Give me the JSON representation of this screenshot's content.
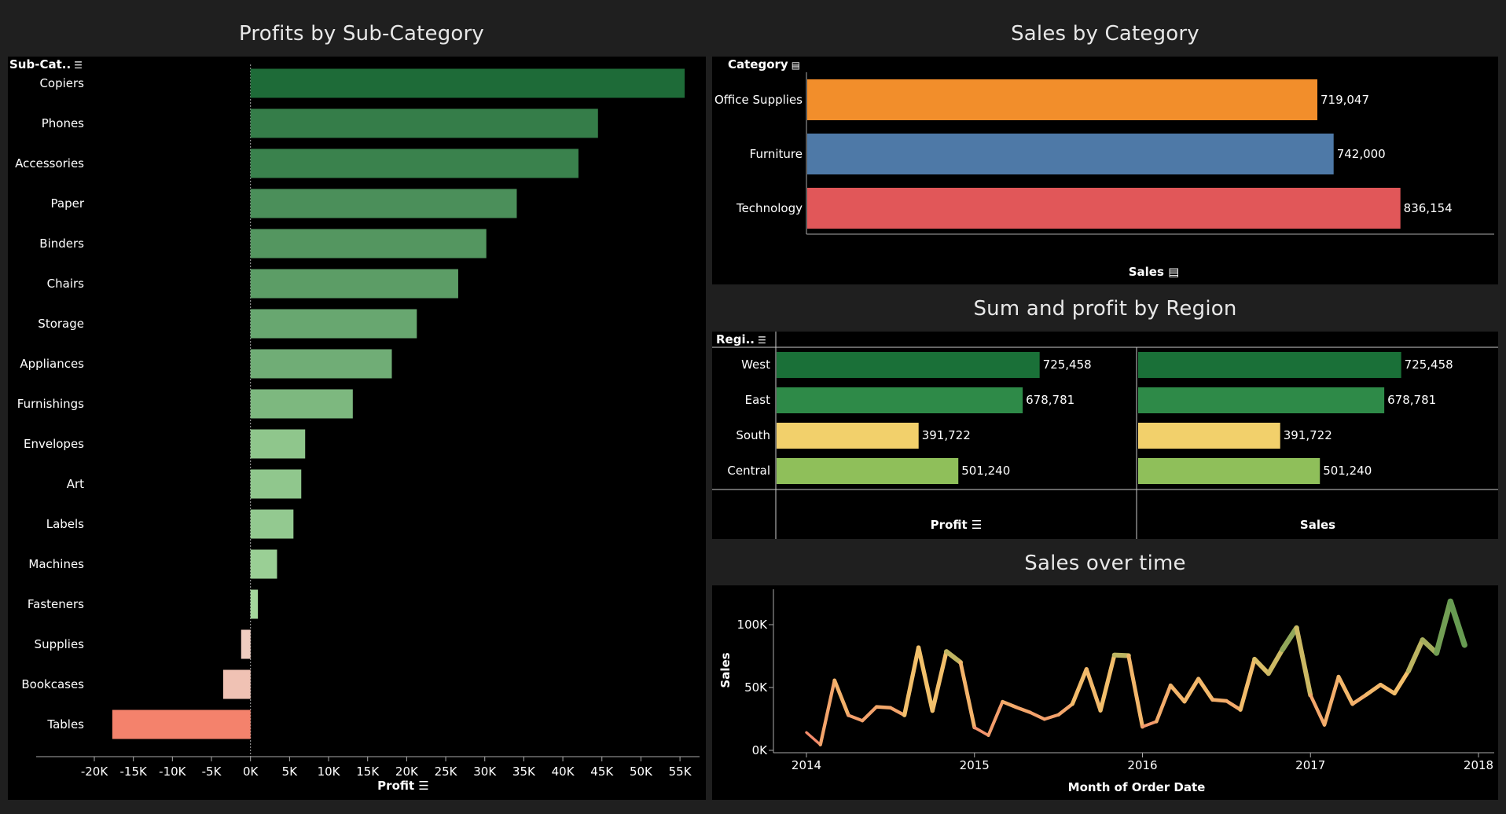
{
  "dashboard": {
    "profits": {
      "title": "Profits by Sub-Category",
      "header": "Sub-Cat..",
      "xlabel": "Profit"
    },
    "category": {
      "title": "Sales by Category",
      "header": "Category",
      "xlabel": "Sales"
    },
    "region": {
      "title": "Sum and profit by Region",
      "header": "Regi..",
      "profit_label": "Profit",
      "sales_label": "Sales"
    },
    "time": {
      "title": "Sales over time",
      "xlabel": "Month of Order Date",
      "ylabel": "Sales"
    }
  },
  "colors": {
    "positive_dark": "#1e6b38",
    "negative": "#f4826c",
    "office_supplies": "#f28e2b",
    "furniture": "#4e79a7",
    "technology": "#e15759",
    "west": "#1a7038",
    "east": "#2e8a48",
    "south": "#f2d06b",
    "central": "#8fbf5a",
    "background": "#000000",
    "canvas": "#1f1f1f"
  },
  "chart_data": [
    {
      "type": "bar",
      "orientation": "horizontal",
      "title": "Profits by Sub-Category",
      "xlabel": "Profit",
      "ylabel": "Sub-Cat..",
      "categories": [
        "Copiers",
        "Phones",
        "Accessories",
        "Paper",
        "Binders",
        "Chairs",
        "Storage",
        "Appliances",
        "Furnishings",
        "Envelopes",
        "Art",
        "Labels",
        "Machines",
        "Fasteners",
        "Supplies",
        "Bookcases",
        "Tables"
      ],
      "values": [
        55600,
        44500,
        42000,
        34100,
        30200,
        26600,
        21300,
        18100,
        13100,
        7000,
        6500,
        5500,
        3400,
        950,
        -1200,
        -3500,
        -17700
      ],
      "xlim": [
        -20000,
        55000
      ],
      "xticks": [
        "-20K",
        "-15K",
        "-10K",
        "-5K",
        "0K",
        "5K",
        "10K",
        "15K",
        "20K",
        "25K",
        "30K",
        "35K",
        "40K",
        "45K",
        "50K",
        "55K"
      ],
      "xtick_values": [
        -20000,
        -15000,
        -10000,
        -5000,
        0,
        5000,
        10000,
        15000,
        20000,
        25000,
        30000,
        35000,
        40000,
        45000,
        50000,
        55000
      ]
    },
    {
      "type": "bar",
      "orientation": "horizontal",
      "title": "Sales by Category",
      "xlabel": "Sales",
      "ylabel": "Category",
      "categories": [
        "Office Supplies",
        "Furniture",
        "Technology"
      ],
      "values": [
        719047,
        742000,
        836154
      ],
      "labels": [
        "719,047",
        "742,000",
        "836,154"
      ]
    },
    {
      "type": "bar",
      "orientation": "horizontal",
      "title": "Sum and profit by Region",
      "ylabel": "Regi..",
      "categories": [
        "West",
        "East",
        "South",
        "Central"
      ],
      "series": [
        {
          "name": "Profit",
          "values": [
            725458,
            678781,
            391722,
            501240
          ],
          "labels": [
            "725,458",
            "678,781",
            "391,722",
            "501,240"
          ]
        },
        {
          "name": "Sales",
          "values": [
            725458,
            678781,
            391722,
            501240
          ],
          "labels": [
            "725,458",
            "678,781",
            "391,722",
            "501,240"
          ]
        }
      ]
    },
    {
      "type": "line",
      "title": "Sales over time",
      "xlabel": "Month of Order Date",
      "ylabel": "Sales",
      "xlim": [
        2014,
        2018
      ],
      "ylim": [
        0,
        125000
      ],
      "xticks": [
        "2014",
        "2015",
        "2016",
        "2017",
        "2018"
      ],
      "xtick_values": [
        2014,
        2015,
        2016,
        2017,
        2018
      ],
      "yticks": [
        "0K",
        "50K",
        "100K"
      ],
      "ytick_values": [
        0,
        50000,
        100000
      ],
      "x": [
        2014.0,
        2014.083,
        2014.167,
        2014.25,
        2014.333,
        2014.417,
        2014.5,
        2014.583,
        2014.667,
        2014.75,
        2014.833,
        2014.917,
        2015.0,
        2015.083,
        2015.167,
        2015.25,
        2015.333,
        2015.417,
        2015.5,
        2015.583,
        2015.667,
        2015.75,
        2015.833,
        2015.917,
        2016.0,
        2016.083,
        2016.167,
        2016.25,
        2016.333,
        2016.417,
        2016.5,
        2016.583,
        2016.667,
        2016.75,
        2016.833,
        2016.917,
        2017.0,
        2017.083,
        2017.167,
        2017.25,
        2017.333,
        2017.417,
        2017.5,
        2017.583,
        2017.667,
        2017.75,
        2017.833,
        2017.917
      ],
      "values": [
        14200,
        4500,
        55700,
        27900,
        23600,
        34600,
        33900,
        28000,
        81800,
        31500,
        78600,
        70000,
        18200,
        11900,
        38700,
        34200,
        30100,
        24800,
        28300,
        36900,
        64600,
        31700,
        75800,
        75300,
        18800,
        22900,
        51700,
        38800,
        56900,
        40300,
        39300,
        32300,
        72600,
        61100,
        80200,
        97400,
        44000,
        20300,
        58600,
        36900,
        44300,
        52200,
        45300,
        63100,
        87900,
        77400,
        118500,
        83800
      ]
    }
  ]
}
